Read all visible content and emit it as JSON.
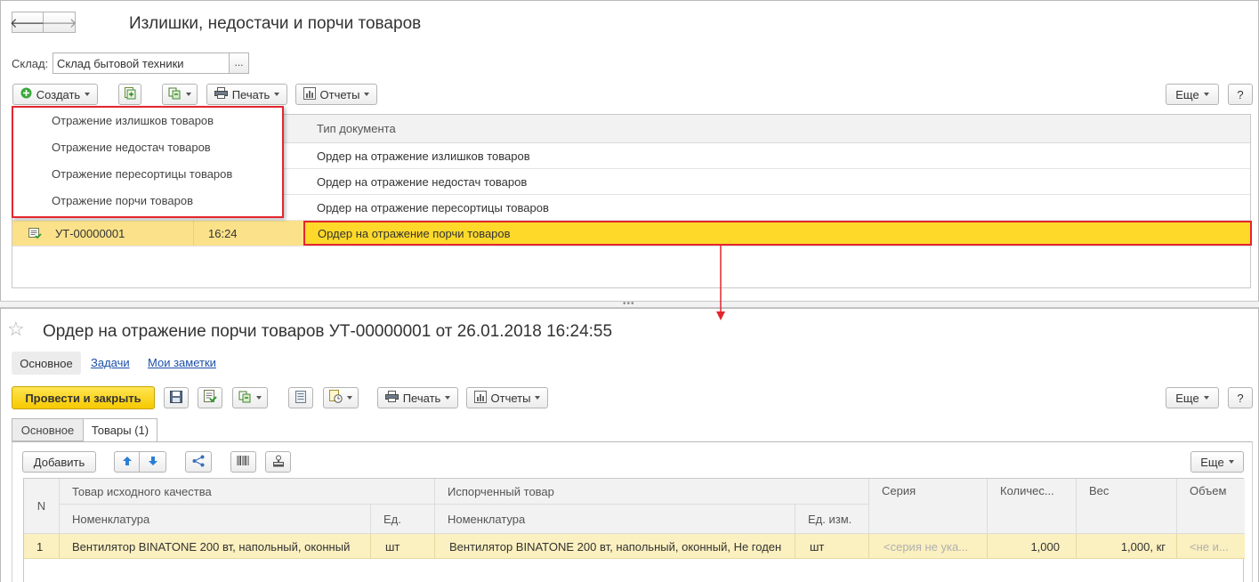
{
  "list_window": {
    "title": "Излишки, недостачи и порчи товаров",
    "nav_back": "🡐",
    "nav_forward": "🡒",
    "warehouse_label": "Склад:",
    "warehouse_value": "Склад бытовой техники",
    "warehouse_select": "...",
    "toolbar": {
      "create_label": "Создать",
      "print_label": "Печать",
      "reports_label": "Отчеты",
      "more_label": "Еще",
      "help_label": "?"
    },
    "create_menu": [
      "Отражение излишков товаров",
      "Отражение недостач товаров",
      "Отражение пересортицы товаров",
      "Отражение порчи товаров"
    ],
    "column_header_type": "Тип документа",
    "rows": [
      {
        "number": "",
        "time": "",
        "type": "Ордер на отражение излишков товаров"
      },
      {
        "number": "",
        "time": "",
        "type": "Ордер на отражение недостач товаров"
      },
      {
        "number": "",
        "time": "",
        "type": "Ордер на отражение пересортицы товаров"
      },
      {
        "number": "УТ-00000001",
        "time": "16:24",
        "type": "Ордер на отражение порчи товаров"
      }
    ]
  },
  "document_window": {
    "title": "Ордер на отражение порчи товаров УТ-00000001 от 26.01.2018 16:24:55",
    "favorite_icon": "☆",
    "sections": {
      "main": "Основное",
      "tasks": "Задачи",
      "notes": "Мои заметки"
    },
    "toolbar": {
      "post_close_label": "Провести и закрыть",
      "print_label": "Печать",
      "reports_label": "Отчеты",
      "more_label": "Еще",
      "help_label": "?"
    },
    "tabs": {
      "main": "Основное",
      "goods": "Товары (1)"
    },
    "goods_toolbar": {
      "add_label": "Добавить",
      "more_label": "Еще"
    },
    "table": {
      "headers": {
        "n": "N",
        "source_group": "Товар исходного качества",
        "source_item": "Номенклатура",
        "source_unit": "Ед.",
        "damaged_group": "Испорченный товар",
        "damaged_item": "Номенклатура",
        "damaged_unit": "Ед. изм.",
        "series": "Серия",
        "quantity": "Количес...",
        "weight": "Вес",
        "volume": "Объем"
      },
      "rows": [
        {
          "n": "1",
          "source_item": "Вентилятор BINATONE 200 вт, напольный, оконный",
          "source_unit": "шт",
          "damaged_item": "Вентилятор BINATONE 200 вт, напольный, оконный, Не годен",
          "damaged_unit": "шт",
          "series": "<серия не ука...",
          "quantity": "1,000",
          "weight": "1,000, кг",
          "volume": "<не и..."
        }
      ]
    }
  },
  "colors": {
    "highlight_border": "#e3262e",
    "selected_row": "#fbe28a",
    "selected_cell": "#ffd92a",
    "primary_button": "#f6c900",
    "link": "#1c4fa8"
  }
}
